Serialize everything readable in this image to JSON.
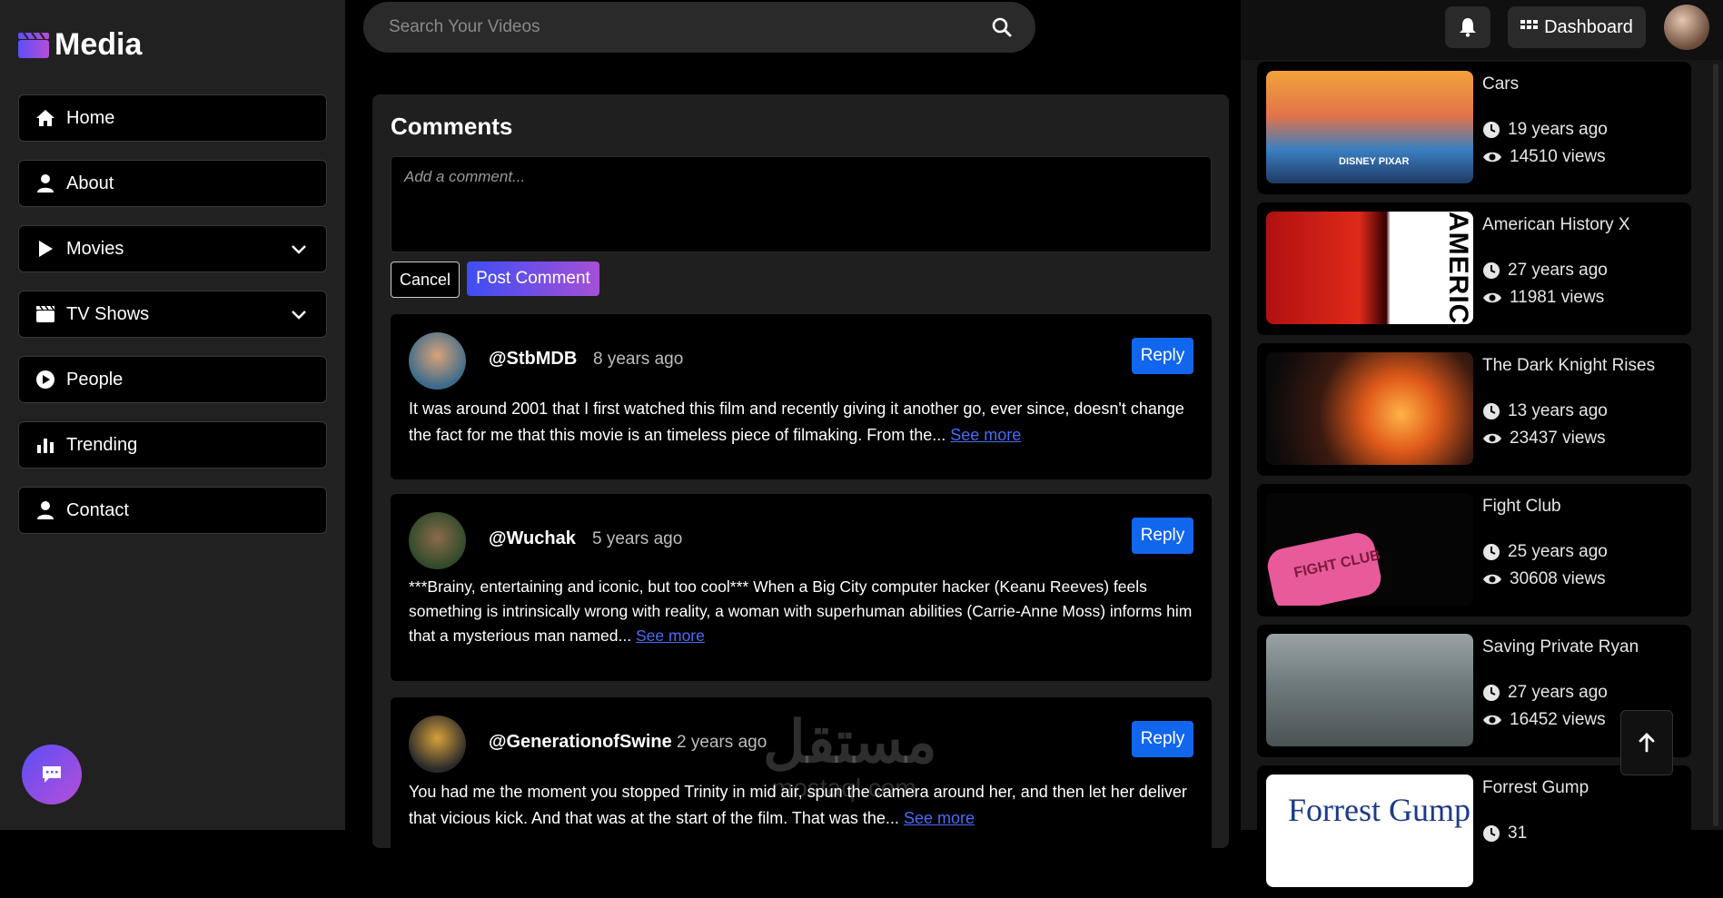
{
  "app": {
    "name": "Media"
  },
  "nav": [
    {
      "label": "Home",
      "icon": "home-icon",
      "dropdown": false
    },
    {
      "label": "About",
      "icon": "user-icon",
      "dropdown": false
    },
    {
      "label": "Movies",
      "icon": "play-icon",
      "dropdown": true
    },
    {
      "label": "TV Shows",
      "icon": "clapperboard-icon",
      "dropdown": true
    },
    {
      "label": "People",
      "icon": "play-circle-icon",
      "dropdown": false
    },
    {
      "label": "Trending",
      "icon": "bar-chart-icon",
      "dropdown": false
    },
    {
      "label": "Contact",
      "icon": "user-icon",
      "dropdown": false
    }
  ],
  "search": {
    "placeholder": "Search Your Videos"
  },
  "header": {
    "dashboard_label": "Dashboard"
  },
  "comments": {
    "title": "Comments",
    "input_placeholder": "Add a comment...",
    "cancel_label": "Cancel",
    "post_label": "Post Comment",
    "reply_label": "Reply",
    "see_more_label": "See more",
    "items": [
      {
        "user": "@StbMDB",
        "time": "8 years ago",
        "text": "It was around 2001 that I first watched this film and recently giving it another go, ever since, doesn't change the fact for me that this movie is an timeless piece of filmaking. From the..."
      },
      {
        "user": "@Wuchak",
        "time": "5 years ago",
        "text": "***Brainy, entertaining and iconic, but too cool*** When a Big City computer hacker (Keanu Reeves) feels something is intrinsically wrong with reality, a woman with superhuman abilities (Carrie-Anne Moss) informs him that a mysterious man named..."
      },
      {
        "user": "@GenerationofSwine",
        "time": "2 years ago",
        "text": "You had me the moment you stopped Trinity in mid air, spun the camera around her, and then let her deliver that vicious kick. And that was at the start of the film. That was the..."
      }
    ]
  },
  "related": [
    {
      "title": "Cars",
      "age": "19 years ago",
      "views": "14510 views"
    },
    {
      "title": "American History X",
      "age": "27 years ago",
      "views": "11981 views"
    },
    {
      "title": "The Dark Knight Rises",
      "age": "13 years ago",
      "views": "23437 views"
    },
    {
      "title": "Fight Club",
      "age": "25 years ago",
      "views": "30608 views"
    },
    {
      "title": "Saving Private Ryan",
      "age": "27 years ago",
      "views": "16452 views"
    },
    {
      "title": "Forrest Gump",
      "age": "31",
      "views": ""
    }
  ],
  "thumbs": {
    "american_text": "AMERIC",
    "forrest_text": "Forrest Gump",
    "fightclub_text": "FIGHT CLUB",
    "cars_text": "DISNEY PIXAR"
  },
  "watermark": {
    "text": "مستقل",
    "sub": "mostaql.com"
  },
  "colors": {
    "accent": "#1166ee",
    "gradient_start": "#3e4ef4",
    "gradient_end": "#a64fd6"
  }
}
